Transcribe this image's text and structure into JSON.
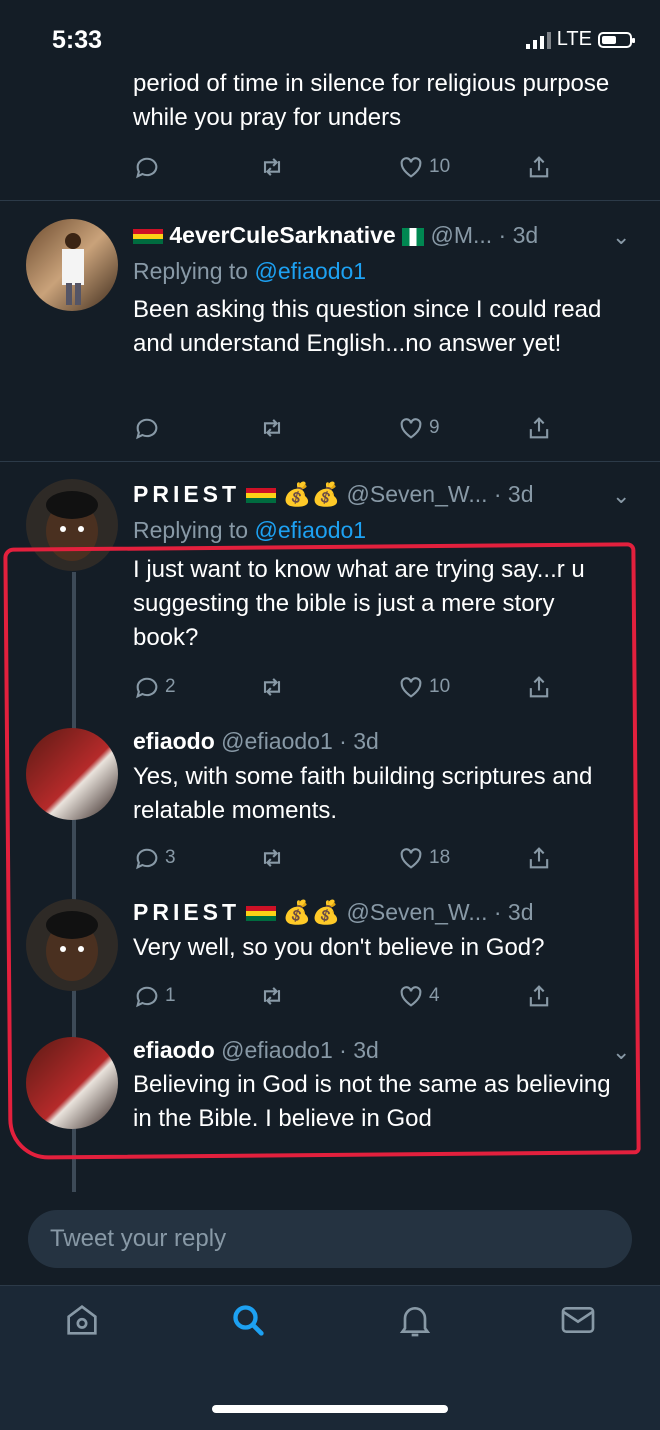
{
  "status": {
    "time": "5:33",
    "network": "LTE"
  },
  "tweets": {
    "top": {
      "text": "period of time in silence for religious purpose while you pray for unders",
      "likes": "10"
    },
    "cule": {
      "name": "4everCuleSarknative",
      "handle_time": "@M... · 3d",
      "replying_prefix": "Replying to",
      "replying_handle": "@efiaodo1",
      "text": "Been asking this question since I could read and understand English...no answer yet!",
      "likes": "9"
    },
    "priest1": {
      "name": "PRIEST",
      "handle_time": "@Seven_W... · 3d",
      "replying_prefix": "Replying to",
      "replying_handle": "@efiaodo1",
      "text": "I just want to know what are trying say...r u suggesting the bible is just a mere story book?",
      "replies": "2",
      "likes": "10"
    },
    "efia1": {
      "name": "efiaodo",
      "handle_time": "@efiaodo1 · 3d",
      "text": "Yes, with some faith building scriptures and relatable moments.",
      "replies": "3",
      "likes": "18"
    },
    "priest2": {
      "name": "PRIEST",
      "handle_time": "@Seven_W... · 3d",
      "text": "Very well, so you don't believe in God?",
      "replies": "1",
      "likes": "4"
    },
    "efia2": {
      "name": "efiaodo",
      "handle_time": "@efiaodo1 · 3d",
      "text": "Believing in God is not the same as believing in the Bible. I believe in God"
    }
  },
  "composer": {
    "placeholder": "Tweet your reply"
  },
  "colors": {
    "background": "#141d26",
    "accent": "#1da1f2",
    "highlight": "#e3203d",
    "muted": "#8899a6"
  },
  "tabs": [
    "home-icon",
    "search-icon",
    "notifications-icon",
    "messages-icon"
  ]
}
